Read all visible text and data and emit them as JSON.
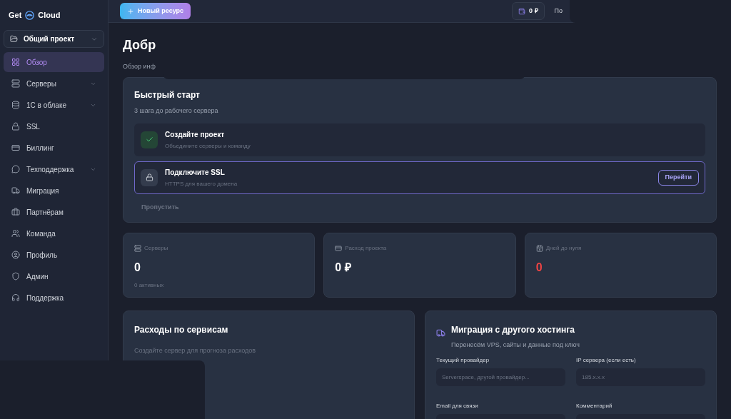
{
  "logo": {
    "left": "Get",
    "right": "Cloud"
  },
  "project_selector": {
    "label": "Общий проект"
  },
  "sidebar": {
    "items": [
      {
        "label": "Обзор",
        "selected": true,
        "expandable": false
      },
      {
        "label": "Серверы",
        "selected": false,
        "expandable": true
      },
      {
        "label": "1С в облаке",
        "selected": false,
        "expandable": true
      },
      {
        "label": "SSL",
        "selected": false,
        "expandable": false
      },
      {
        "label": "Биллинг",
        "selected": false,
        "expandable": false
      },
      {
        "label": "Техподдержка",
        "selected": false,
        "expandable": true
      },
      {
        "label": "Миграция",
        "selected": false,
        "expandable": false
      },
      {
        "label": "Партнёрам",
        "selected": false,
        "expandable": false
      },
      {
        "label": "Команда",
        "selected": false,
        "expandable": false
      },
      {
        "label": "Профиль",
        "selected": false,
        "expandable": false
      },
      {
        "label": "Админ",
        "selected": false,
        "expandable": false
      },
      {
        "label": "Поддержка",
        "selected": false,
        "expandable": false
      }
    ]
  },
  "header": {
    "new_resource": "Новый ресурс",
    "balance": "0 ₽",
    "cut_link": "По"
  },
  "welcome": {
    "title": "Добр",
    "subtitle": "Обзор инф"
  },
  "quick_start": {
    "title": "Быстрый старт",
    "subtitle": "3 шага до рабочего сервера",
    "steps": [
      {
        "title": "Создайте проект",
        "description": "Объедините серверы и команду",
        "done": true
      },
      {
        "title": "Подключите SSL",
        "description": "HTTPS для вашего домена",
        "done": false,
        "action": "Перейти"
      }
    ],
    "skip": "Пропустить"
  },
  "stats": [
    {
      "label": "Серверы",
      "value": "0",
      "note": "0 активных",
      "warning": false
    },
    {
      "label": "Расход проекта",
      "value": "0 ₽",
      "warning": false
    },
    {
      "label": "Дней до нуля",
      "value": "0",
      "warning": true
    }
  ],
  "expenses": {
    "title": "Расходы по сервисам",
    "empty_text": "Создайте сервер для прогноза расходов"
  },
  "migration": {
    "title": "Миграция с другого хостинга",
    "subtitle": "Перенесём VPS, сайты и данные под ключ",
    "fields": [
      {
        "label": "Текущий провайдер",
        "placeholder": "Serverspace, другой провайдер..."
      },
      {
        "label": "IP сервера (если есть)",
        "placeholder": "185.x.x.x"
      },
      {
        "label": "Email для связи"
      },
      {
        "label": "Комментарий"
      }
    ]
  }
}
